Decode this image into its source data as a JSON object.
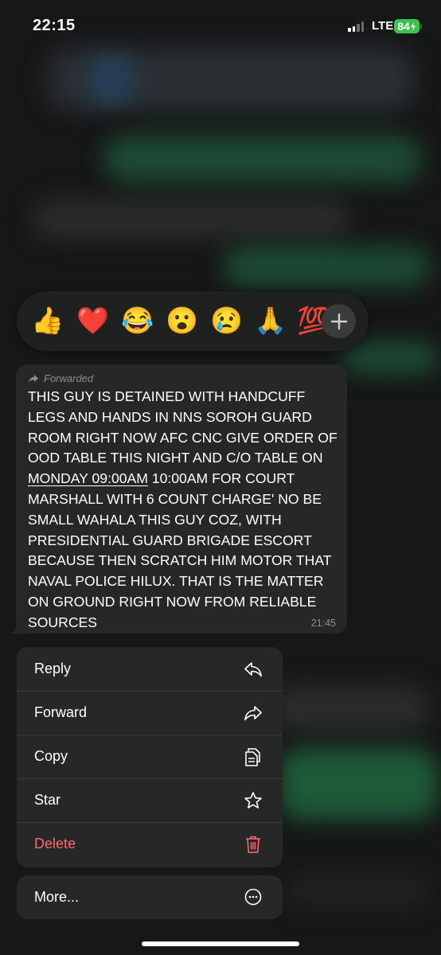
{
  "status_bar": {
    "time": "22:15",
    "network": "LTE",
    "battery": "84"
  },
  "reactions": {
    "emojis": [
      "👍",
      "❤️",
      "😂",
      "😮",
      "😢",
      "🙏",
      "💯"
    ],
    "add_icon": "plus-icon"
  },
  "message": {
    "forwarded_label": "Forwarded",
    "text_before": "THIS GUY IS DETAINED WITH HANDCUFF LEGS AND HANDS IN NNS SOROH GUARD ROOM RIGHT NOW AFC CNC GIVE ORDER OF OOD TABLE THIS NIGHT AND C/O TABLE ON ",
    "text_link": "MONDAY 09:00AM",
    "text_after": "  10:00AM FOR COURT MARSHALL WITH 6 COUNT CHARGE' NO BE SMALL WAHALA THIS GUY COZ, WITH PRESIDENTIAL GUARD BRIGADE ESCORT BECAUSE THEN SCRATCH HIM MOTOR THAT NAVAL POLICE HILUX.  THAT IS THE MATTER ON GROUND RIGHT NOW FROM RELIABLE SOURCES",
    "time": "21:45"
  },
  "menu": {
    "items": [
      {
        "label": "Reply",
        "icon": "reply-icon"
      },
      {
        "label": "Forward",
        "icon": "forward-icon"
      },
      {
        "label": "Copy",
        "icon": "copy-icon"
      },
      {
        "label": "Star",
        "icon": "star-icon"
      },
      {
        "label": "Delete",
        "icon": "trash-icon"
      }
    ],
    "more_label": "More...",
    "more_icon": "more-icon"
  },
  "colors": {
    "delete": "#ff6a6a",
    "battery": "#3ac34b",
    "panel": "#262828"
  }
}
